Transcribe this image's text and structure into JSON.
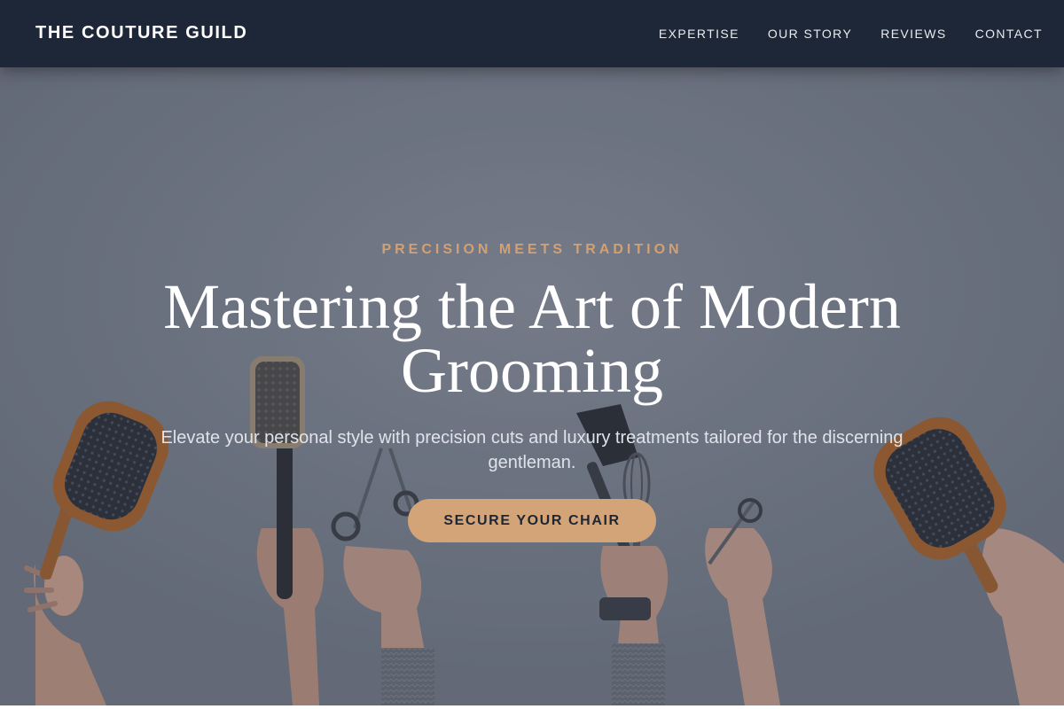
{
  "header": {
    "brand": "THE COUTURE GUILD",
    "nav": [
      {
        "label": "EXPERTISE"
      },
      {
        "label": "OUR STORY"
      },
      {
        "label": "REVIEWS"
      },
      {
        "label": "CONTACT"
      }
    ]
  },
  "hero": {
    "eyebrow": "PRECISION MEETS TRADITION",
    "headline": "Mastering the Art of Modern Grooming",
    "subtitle": "Elevate your personal style with precision cuts and luxury treatments tailored for the discerning gentleman.",
    "cta_label": "SECURE YOUR CHAIR"
  },
  "colors": {
    "nav_bg": "#1e2738",
    "accent": "#d3a477",
    "eyebrow": "#d2a173",
    "headline": "#ffffff"
  },
  "background_icons": [
    "hair-brush-icon",
    "round-brush-icon",
    "scissors-icon",
    "tint-brush-icon",
    "whisk-icon",
    "thinning-shears-icon",
    "paddle-brush-icon"
  ]
}
